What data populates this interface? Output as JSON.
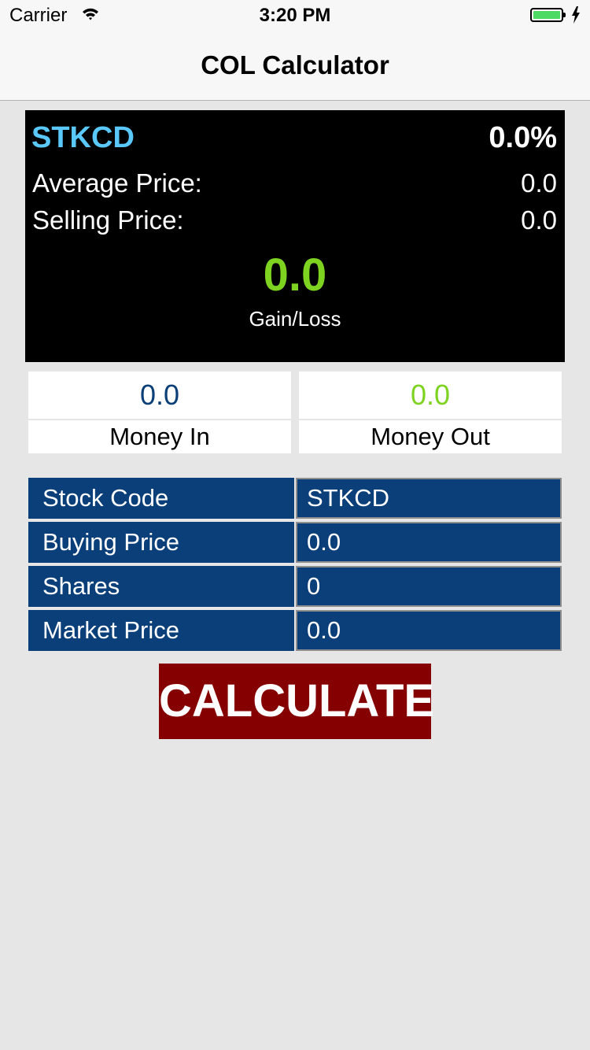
{
  "status_bar": {
    "carrier": "Carrier",
    "time": "3:20 PM",
    "battery_level": 1.0,
    "battery_color": "#4cd964"
  },
  "nav": {
    "title": "COL Calculator"
  },
  "result": {
    "stock_code": "STKCD",
    "percent": "0.0%",
    "average_price_label": "Average Price:",
    "average_price_value": "0.0",
    "selling_price_label": "Selling Price:",
    "selling_price_value": "0.0",
    "gain_loss_value": "0.0",
    "gain_loss_label": "Gain/Loss"
  },
  "money": {
    "in_value": "0.0",
    "in_label": "Money In",
    "out_value": "0.0",
    "out_label": "Money Out"
  },
  "form": {
    "fields": [
      {
        "label": "Stock Code",
        "value": "STKCD"
      },
      {
        "label": "Buying Price",
        "value": "0.0"
      },
      {
        "label": "Shares",
        "value": "0"
      },
      {
        "label": "Market Price",
        "value": "0.0"
      }
    ]
  },
  "calculate_label": "CALCULATE",
  "colors": {
    "panel_bg": "#000000",
    "stock_code": "#5ac8fa",
    "gain_value": "#7ed321",
    "form_bg": "#0b3f7a",
    "button_bg": "#850000"
  }
}
